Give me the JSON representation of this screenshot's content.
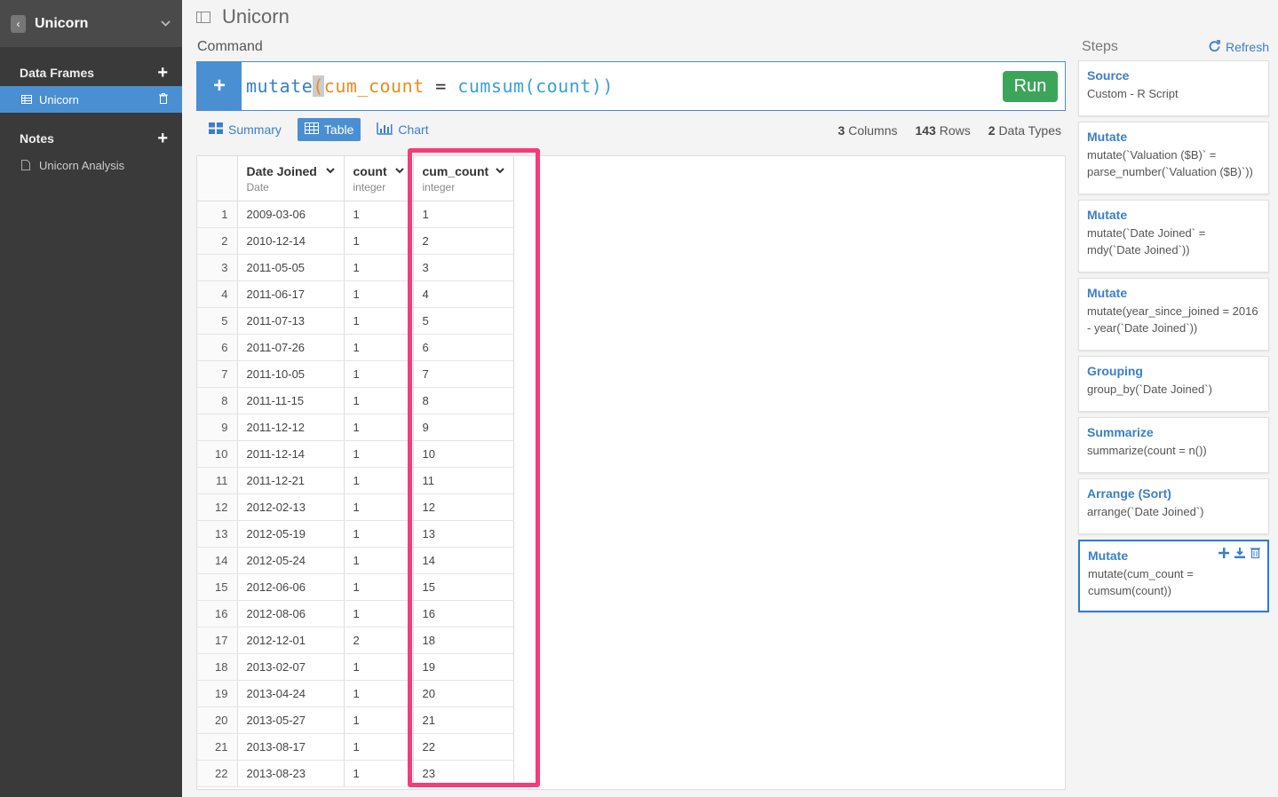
{
  "sidebar": {
    "project_title": "Unicorn",
    "data_frames_title": "Data Frames",
    "data_frames": [
      {
        "label": "Unicorn"
      }
    ],
    "notes_title": "Notes",
    "notes": [
      {
        "label": "Unicorn Analysis"
      }
    ]
  },
  "header": {
    "title": "Unicorn"
  },
  "command": {
    "label": "Command",
    "code_fn": "mutate",
    "code_open": "(",
    "code_var": "cum_count",
    "code_eq": " = ",
    "code_fn2": "cumsum",
    "code_arg": "(count))",
    "run_label": "Run"
  },
  "tabs": {
    "summary": "Summary",
    "table": "Table",
    "chart": "Chart"
  },
  "stats": {
    "columns_num": "3",
    "columns_label": "Columns",
    "rows_num": "143",
    "rows_label": "Rows",
    "types_num": "2",
    "types_label": "Data Types"
  },
  "table": {
    "columns": [
      {
        "name": "Date Joined",
        "type": "Date"
      },
      {
        "name": "count",
        "type": "integer"
      },
      {
        "name": "cum_count",
        "type": "integer"
      }
    ],
    "rows": [
      [
        "1",
        "2009-03-06",
        "1",
        "1"
      ],
      [
        "2",
        "2010-12-14",
        "1",
        "2"
      ],
      [
        "3",
        "2011-05-05",
        "1",
        "3"
      ],
      [
        "4",
        "2011-06-17",
        "1",
        "4"
      ],
      [
        "5",
        "2011-07-13",
        "1",
        "5"
      ],
      [
        "6",
        "2011-07-26",
        "1",
        "6"
      ],
      [
        "7",
        "2011-10-05",
        "1",
        "7"
      ],
      [
        "8",
        "2011-11-15",
        "1",
        "8"
      ],
      [
        "9",
        "2011-12-12",
        "1",
        "9"
      ],
      [
        "10",
        "2011-12-14",
        "1",
        "10"
      ],
      [
        "11",
        "2011-12-21",
        "1",
        "11"
      ],
      [
        "12",
        "2012-02-13",
        "1",
        "12"
      ],
      [
        "13",
        "2012-05-19",
        "1",
        "13"
      ],
      [
        "14",
        "2012-05-24",
        "1",
        "14"
      ],
      [
        "15",
        "2012-06-06",
        "1",
        "15"
      ],
      [
        "16",
        "2012-08-06",
        "1",
        "16"
      ],
      [
        "17",
        "2012-12-01",
        "2",
        "18"
      ],
      [
        "18",
        "2013-02-07",
        "1",
        "19"
      ],
      [
        "19",
        "2013-04-24",
        "1",
        "20"
      ],
      [
        "20",
        "2013-05-27",
        "1",
        "21"
      ],
      [
        "21",
        "2013-08-17",
        "1",
        "22"
      ],
      [
        "22",
        "2013-08-23",
        "1",
        "23"
      ]
    ]
  },
  "steps": {
    "title": "Steps",
    "refresh_label": "Refresh",
    "items": [
      {
        "name": "Source",
        "desc": "Custom - R Script"
      },
      {
        "name": "Mutate",
        "desc": "mutate(`Valuation ($B)` = parse_number(`Valuation ($B)`))"
      },
      {
        "name": "Mutate",
        "desc": "mutate(`Date Joined` = mdy(`Date Joined`))"
      },
      {
        "name": "Mutate",
        "desc": "mutate(year_since_joined = 2016 - year(`Date Joined`))"
      },
      {
        "name": "Grouping",
        "desc": "group_by(`Date Joined`)"
      },
      {
        "name": "Summarize",
        "desc": "summarize(count = n())"
      },
      {
        "name": "Arrange (Sort)",
        "desc": "arrange(`Date Joined`)"
      },
      {
        "name": "Mutate",
        "desc": "mutate(cum_count = cumsum(count))"
      }
    ]
  },
  "colors": {
    "accent": "#4a8fd1",
    "run": "#3da559",
    "highlight": "#f63b7a",
    "sidebar": "#3a3a3a"
  }
}
